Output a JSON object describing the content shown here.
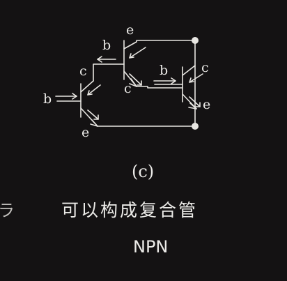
{
  "terminals": {
    "t1_base": "b",
    "t1_collector": "c",
    "t1_emitter": "e",
    "t2_base": "b",
    "t2_emitter": "e",
    "t2_collector": "c",
    "t3_base": "b",
    "t3_collector": "c",
    "t3_emitter": "e"
  },
  "caption": "(c)",
  "sentence": "可以构成复合管",
  "type_label": "NPN",
  "edge_glyph": "ラ",
  "colors": {
    "background": "#141213",
    "line": "#e8e6e2"
  }
}
